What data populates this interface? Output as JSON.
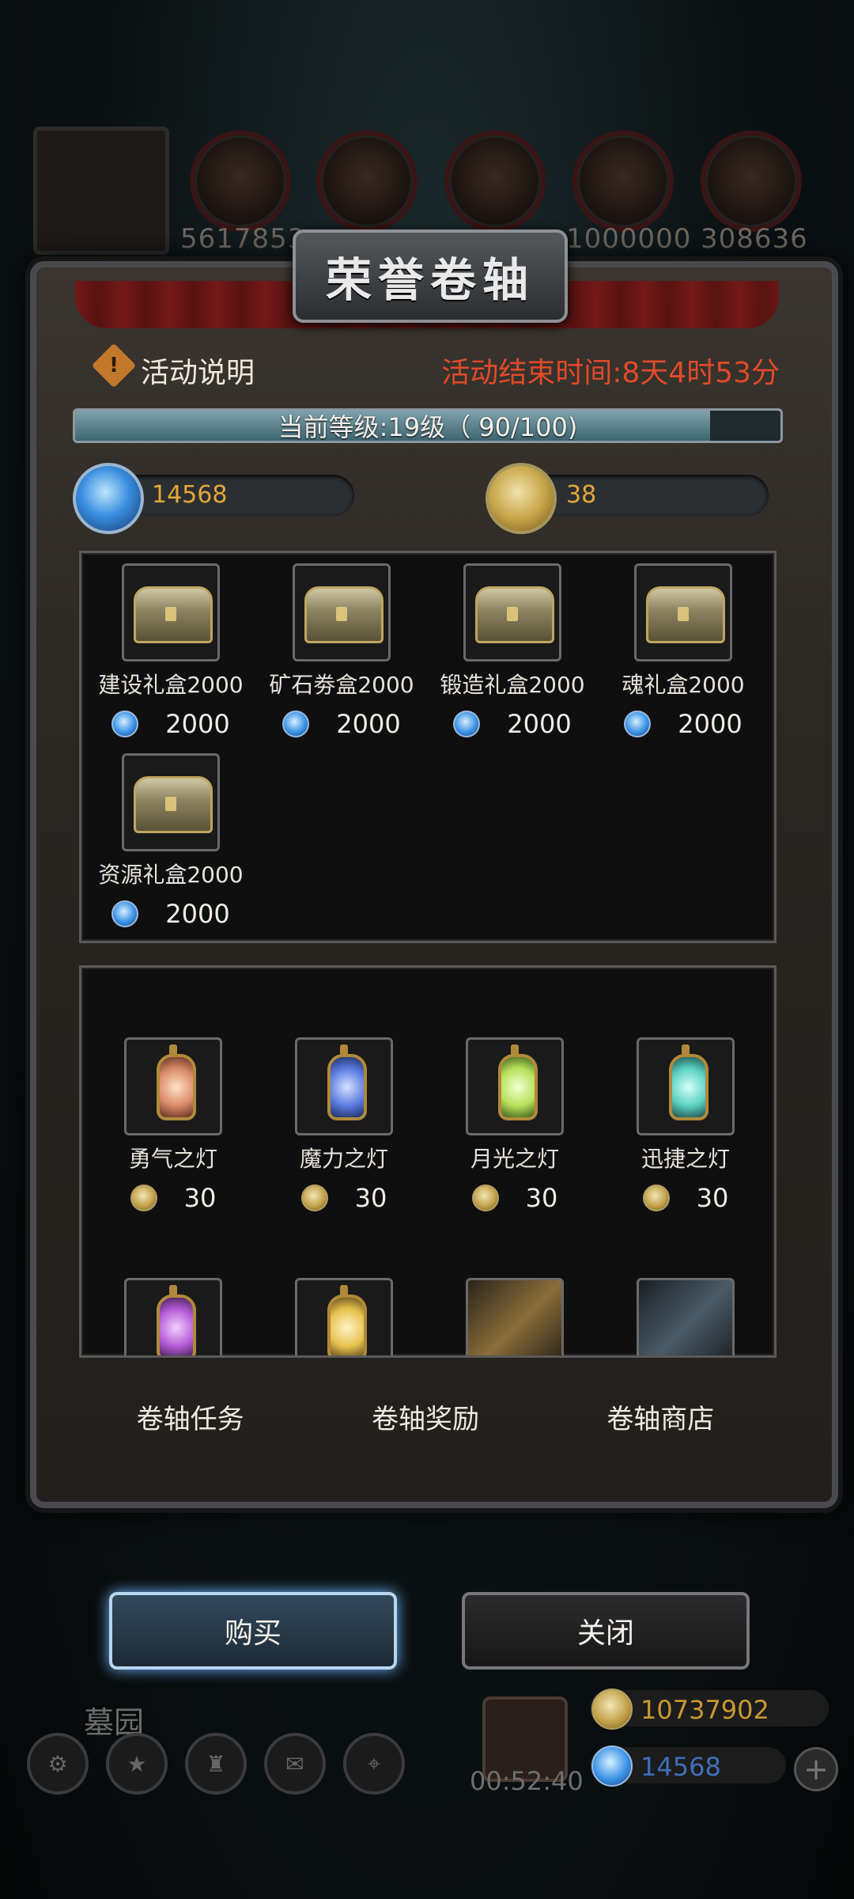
{
  "top_bar": {
    "resources": [
      {
        "name": "wood",
        "value": "5617853"
      },
      {
        "name": "ore",
        "value": ""
      },
      {
        "name": "iron",
        "value": ""
      },
      {
        "name": "crystal",
        "value": "1000000"
      },
      {
        "name": "stone",
        "value": "308636"
      }
    ]
  },
  "modal": {
    "title": "荣誉卷轴",
    "info_label": "活动说明",
    "end_time": "活动结束时间:8天4时53分",
    "level_text": "当前等级:19级（ 90/100)",
    "level_progress": 0.9,
    "gems": "14568",
    "coins": "38",
    "gem_shop": [
      {
        "name": "建设礼盒2000",
        "price": "2000"
      },
      {
        "name": "矿石劵盒2000",
        "price": "2000"
      },
      {
        "name": "锻造礼盒2000",
        "price": "2000"
      },
      {
        "name": "魂礼盒2000",
        "price": "2000"
      },
      {
        "name": "资源礼盒2000",
        "price": "2000"
      }
    ],
    "coin_shop": [
      {
        "name": "勇气之灯",
        "price": "30",
        "glow": "#d98a6a"
      },
      {
        "name": "魔力之灯",
        "price": "30",
        "glow": "#5a7be0"
      },
      {
        "name": "月光之灯",
        "price": "30",
        "glow": "#b7e05a"
      },
      {
        "name": "迅捷之灯",
        "price": "30",
        "glow": "#5ad1c2"
      }
    ],
    "coin_shop_partial_glows": [
      "#b55ad6",
      "#e6c24c"
    ],
    "tabs": [
      "卷轴任务",
      "卷轴奖励",
      "卷轴商店"
    ]
  },
  "buttons": {
    "buy": "购买",
    "close": "关闭"
  },
  "bottom": {
    "location_label": "墓园",
    "timer": "00:52:40",
    "gold": "10737902",
    "gems": "14568",
    "gold_color": "#c99a2e",
    "gem_color": "#3e6fb8"
  }
}
